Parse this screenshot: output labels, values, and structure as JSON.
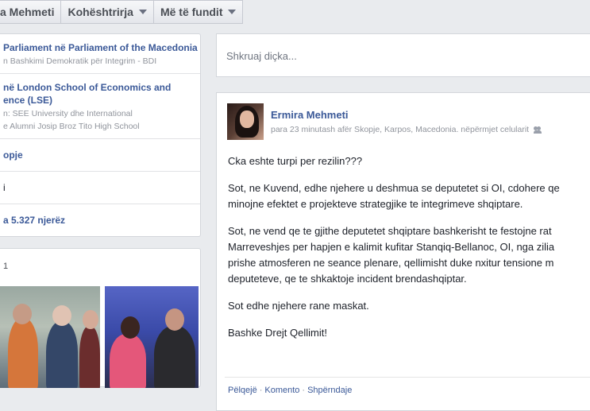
{
  "topbar": {
    "name_button": "a Mehmeti",
    "tab_cohesion": "Kohështrirja",
    "tab_recent": "Më të fundit"
  },
  "about": {
    "items": [
      {
        "title_prefix": "Parliament në ",
        "title_link": "Parliament of the Macedonia",
        "sub": "n Bashkimi Demokratik për Integrim - BDI"
      },
      {
        "title_prefix": " në ",
        "title_link": "London School of Economics and",
        "title_line2": "ence (LSE)",
        "sub": "n: SEE University dhe International",
        "sub2": "e Alumni Josip Broz Tito High School"
      }
    ],
    "city": "opje",
    "row4": "i",
    "followers": "a 5.327 njerëz"
  },
  "photos": {
    "count": "1"
  },
  "composer": {
    "placeholder": "Shkruaj diçka..."
  },
  "post": {
    "author": "Ermira Mehmeti",
    "meta": "para 23 minutash afër Skopje, Karpos, Macedonia. nëpërmjet celularit",
    "paragraphs": [
      [
        "Cka eshte turpi per rezilin???"
      ],
      [
        "Sot, ne Kuvend, edhe njehere u deshmua se deputetet si OI, cdohere qe",
        "minojne efektet e projekteve strategjike te integrimeve shqiptare."
      ],
      [
        "Sot, ne vend qe te gjithe deputetet shqiptare bashkerisht te festojne rat",
        "Marreveshjes per hapjen e kalimit kufitar Stanqiq-Bellanoc, OI, nga zilia",
        "prishe atmosferen ne seance plenare, qellimisht duke nxitur tensione m",
        "deputeteve, qe te shkaktoje incident brendashqiptar."
      ],
      [
        "Sot edhe njehere rane maskat."
      ],
      [
        "Bashke Drejt Qellimit!"
      ]
    ],
    "actions": {
      "like": "Pëlqejë",
      "comment": "Komento",
      "share": "Shpërndaje",
      "separator": "·"
    }
  },
  "colors": {
    "link": "#3b5998",
    "background": "#e9ebee"
  }
}
